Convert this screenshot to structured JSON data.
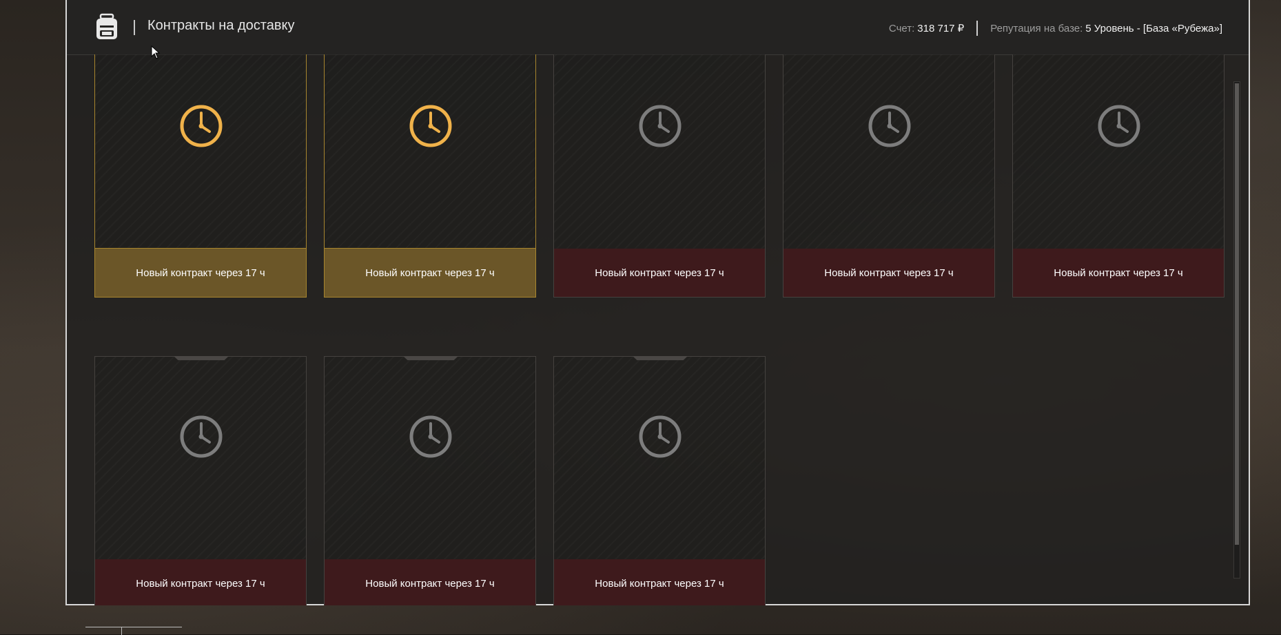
{
  "header": {
    "title": "Контракты на доставку",
    "account_label": "Счет:",
    "account_value": "318 717 ₽",
    "reputation_label": "Репутация на базе:",
    "reputation_value": "5 Уровень - [База «Рубежа»]"
  },
  "icons": {
    "logo": "backpack-icon",
    "card": "clock-icon",
    "cursor": "mouse-cursor-icon"
  },
  "colors": {
    "active_accent": "#f0b24a",
    "inactive_icon": "#7d7d7d",
    "inactive_footer": "#3e1a1c",
    "active_footer": "#6b5628"
  },
  "cards": [
    {
      "label": "Новый контракт через 17 ч",
      "active": true
    },
    {
      "label": "Новый контракт через 17 ч",
      "active": true
    },
    {
      "label": "Новый контракт через 17 ч",
      "active": false
    },
    {
      "label": "Новый контракт через 17 ч",
      "active": false
    },
    {
      "label": "Новый контракт через 17 ч",
      "active": false
    },
    {
      "label": "Новый контракт через 17 ч",
      "active": false
    },
    {
      "label": "Новый контракт через 17 ч",
      "active": false
    },
    {
      "label": "Новый контракт через 17 ч",
      "active": false
    }
  ]
}
